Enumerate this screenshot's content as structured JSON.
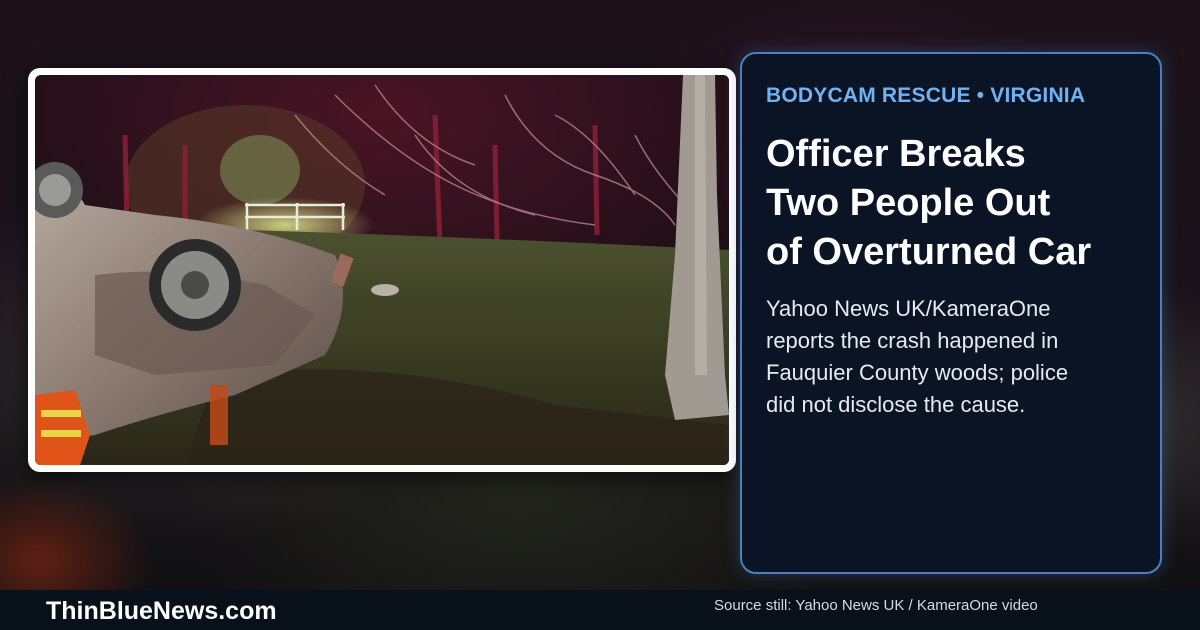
{
  "card": {
    "kicker": "BODYCAM RESCUE • VIRGINIA",
    "headline_lines": [
      "Officer Breaks",
      "Two People Out",
      "of Overturned Car"
    ],
    "summary_lines": [
      "Yahoo News UK/KameraOne",
      "reports the crash happened in",
      "Fauquier County woods; police",
      "did not disclose the cause."
    ]
  },
  "footer": {
    "brand": "ThinBlueNews.com",
    "source": "Source still: Yahoo News UK / KameraOne video"
  },
  "photo": {
    "description_icon": "overturned-car-night-photo"
  },
  "colors": {
    "card_bg": "#0b1424",
    "card_border": "#4a7fc2",
    "kicker": "#6fb3f2",
    "footer_bg": "#081019"
  }
}
